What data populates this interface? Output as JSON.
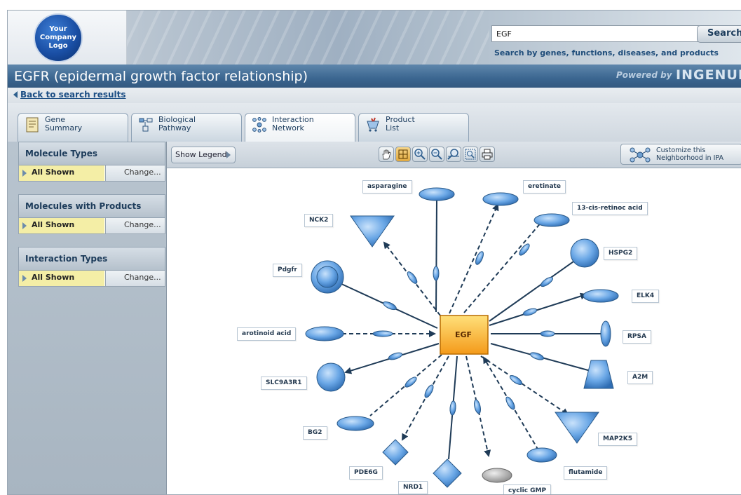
{
  "logo": {
    "text": "Your\nCompany\nLogo"
  },
  "search": {
    "value": "EGF",
    "button": "Search",
    "help": "Search by genes, functions, diseases, and products"
  },
  "title_bar": {
    "title": "EGFR (epidermal growth factor relationship)",
    "powered_by": "Powered by",
    "brand": "INGENUIT"
  },
  "back_link": "Back to search results",
  "tabs": [
    {
      "label": "Gene\nSummary",
      "icon": "document-icon",
      "active": false
    },
    {
      "label": "Biological\nPathway",
      "icon": "pathway-icon",
      "active": false
    },
    {
      "label": "Interaction\nNetwork",
      "icon": "network-icon",
      "active": true
    },
    {
      "label": "Product\nList",
      "icon": "cart-icon",
      "active": false
    }
  ],
  "sidebar": {
    "sections": [
      {
        "title": "Molecule Types",
        "status": "All Shown",
        "change": "Change..."
      },
      {
        "title": "Molecules with Products",
        "status": "All Shown",
        "change": "Change..."
      },
      {
        "title": "Interaction Types",
        "status": "All Shown",
        "change": "Change..."
      }
    ]
  },
  "toolbar": {
    "legend": "Show Legend",
    "tools": [
      "hand-icon",
      "fit-icon",
      "zoom-in-icon",
      "zoom-out-icon",
      "zoom-reset-icon",
      "zoom-box-icon",
      "print-icon"
    ],
    "customize": "Customize this\nNeighborhood in IPA"
  },
  "network": {
    "center": "EGF",
    "nodes": [
      "asparagine",
      "eretinate",
      "13-cis-retinoc acid",
      "NCK2",
      "HSPG2",
      "Pdgfr",
      "ELK4",
      "arotinoid acid",
      "RPSA",
      "SLC9A3R1",
      "A2M",
      "BG2",
      "MAP2K5",
      "PDE6G",
      "flutamide",
      "NRD1",
      "cyclic GMP"
    ]
  },
  "colors": {
    "title_bar": "#3b6690",
    "status_highlight": "#f4eea6",
    "node_blue": "#5b9be0",
    "center_orange": "#f5a623"
  }
}
